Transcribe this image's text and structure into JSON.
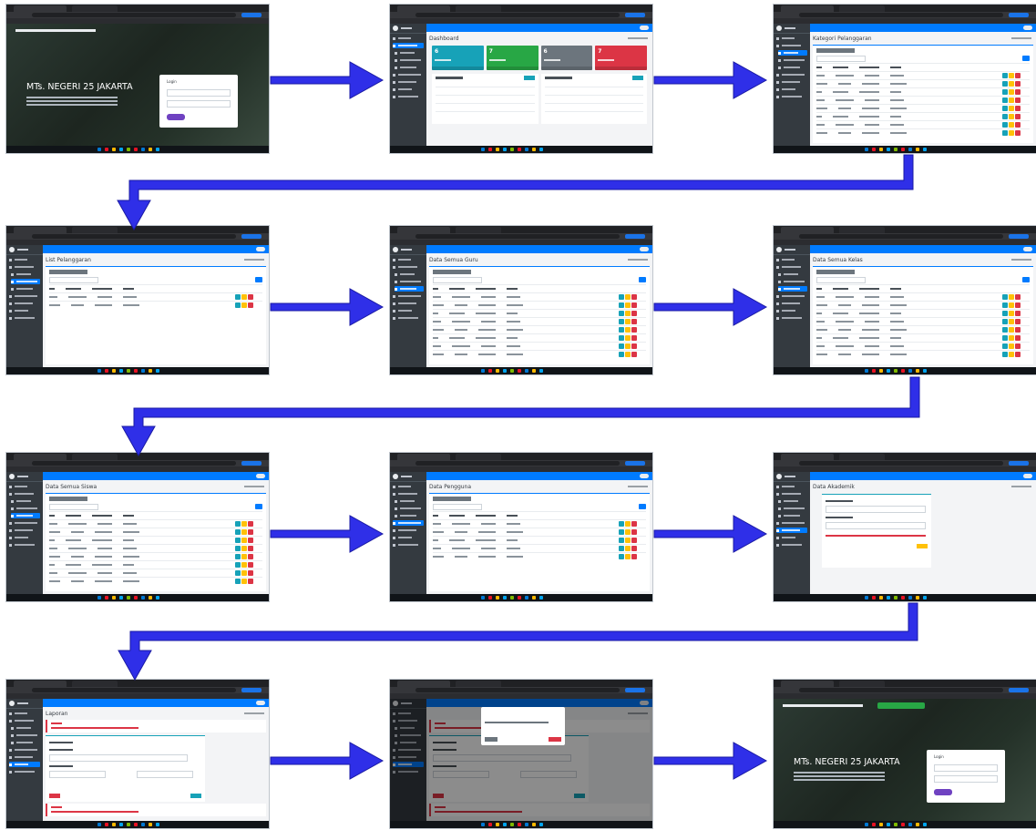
{
  "colors": {
    "arrow": "#2f2fe8",
    "arrow_outline": "#1a1aa3",
    "sidebar": "#343a40",
    "navbar": "#007bff"
  },
  "flow": {
    "steps": [
      {
        "id": "login",
        "label": "",
        "kind": "landing"
      },
      {
        "id": "dashboard",
        "label": "Dashboard",
        "kind": "dashboard"
      },
      {
        "id": "kategori",
        "label": "Kategori Pelanggaran",
        "kind": "table"
      },
      {
        "id": "list-pelanggaran",
        "label": "List Pelanggaran",
        "kind": "table"
      },
      {
        "id": "data-semua-guru",
        "label": "Data Semua Guru",
        "kind": "table"
      },
      {
        "id": "data-semua-kelas",
        "label": "Data Semua Kelas",
        "kind": "table"
      },
      {
        "id": "data-semua-siswa",
        "label": "Data Semua Siswa",
        "kind": "table"
      },
      {
        "id": "data-pengguna",
        "label": "Data Pengguna",
        "kind": "table"
      },
      {
        "id": "data-akademik",
        "label": "Data Akademik",
        "kind": "form"
      },
      {
        "id": "laporan",
        "label": "Laporan",
        "kind": "report"
      },
      {
        "id": "logout-modal",
        "label": "",
        "kind": "modal"
      },
      {
        "id": "login-success",
        "label": "",
        "kind": "landing"
      }
    ]
  },
  "landing": {
    "school": "MTs. NEGERI 25 JAKARTA",
    "login_title": "Login"
  },
  "dashboard": {
    "box_values": [
      "6",
      "7",
      "6",
      "7"
    ],
    "box_colors": [
      "#17a2b8",
      "#28a745",
      "#6c757d",
      "#dc3545"
    ]
  }
}
